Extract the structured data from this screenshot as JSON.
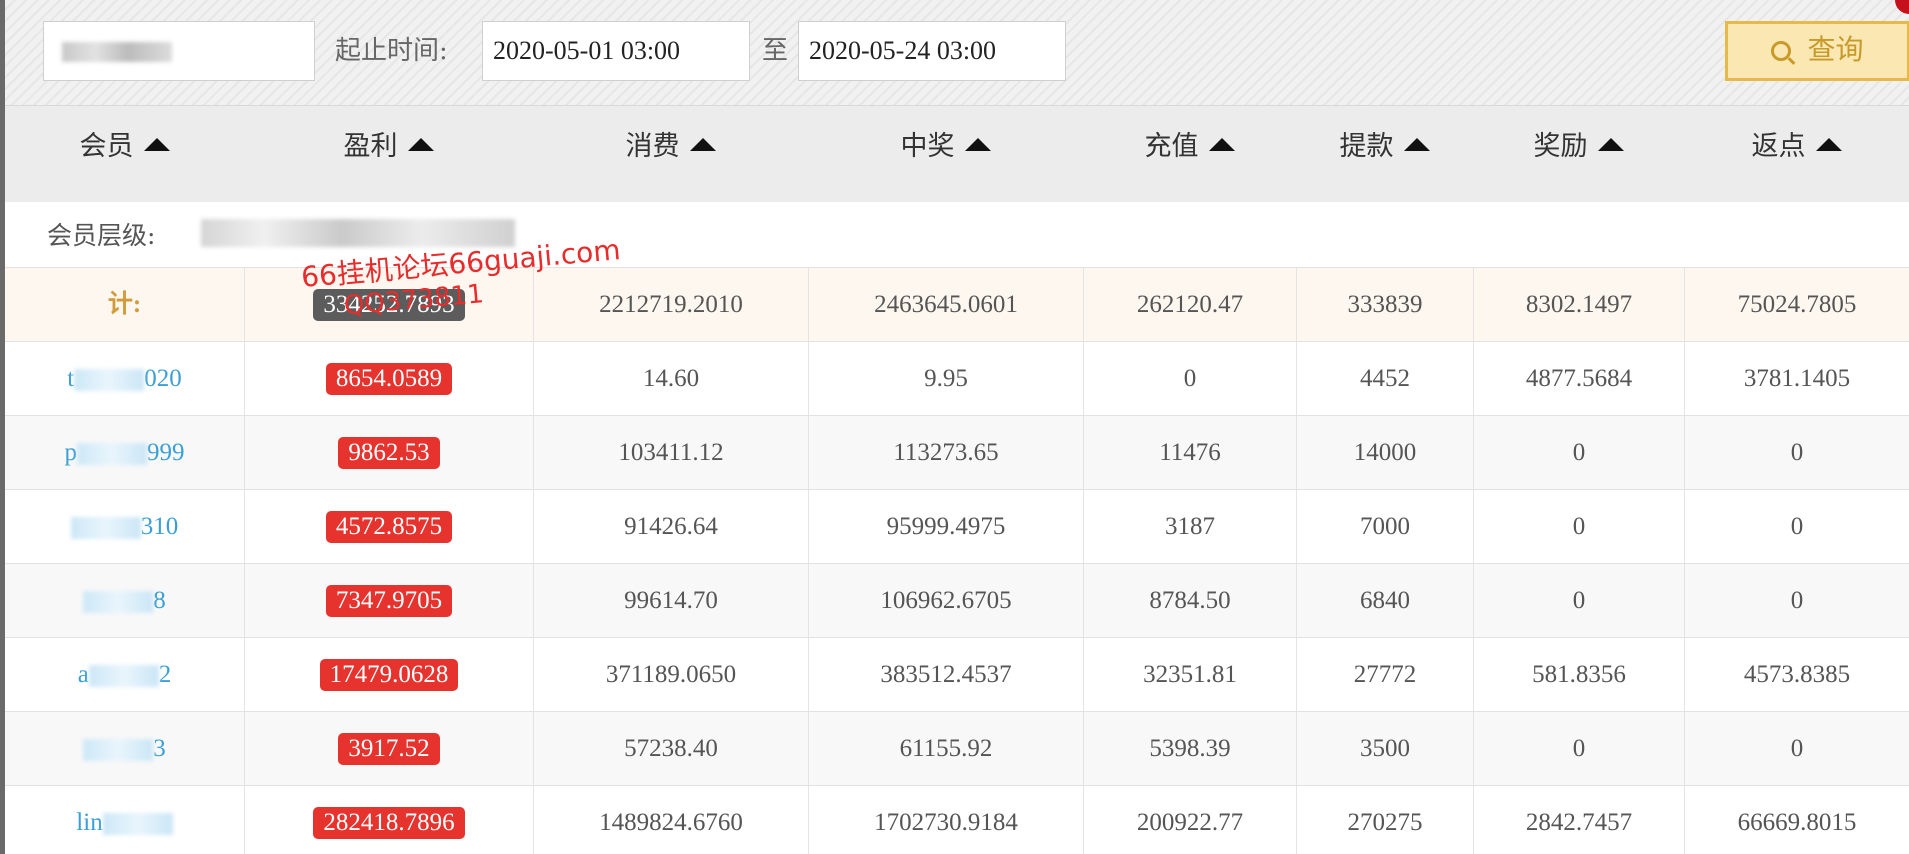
{
  "filters": {
    "time_label": "起止时间:",
    "start_date": "2020-05-01 03:00",
    "to_label": "至",
    "end_date": "2020-05-24 03:00",
    "query_label": "查询"
  },
  "columns": [
    "会员",
    "盈利",
    "消费",
    "中奖",
    "充值",
    "提款",
    "奖励",
    "返点"
  ],
  "level_label": "会员层级:",
  "total": {
    "label": "计:",
    "profit": "334252.7893",
    "consume": "2212719.2010",
    "win": "2463645.0601",
    "recharge": "262120.47",
    "withdraw": "333839",
    "reward": "8302.1497",
    "rebate": "75024.7805"
  },
  "rows": [
    {
      "member_prefix": "t",
      "member_suffix": "020",
      "profit": "8654.0589",
      "consume": "14.60",
      "win": "9.95",
      "recharge": "0",
      "withdraw": "4452",
      "reward": "4877.5684",
      "rebate": "3781.1405"
    },
    {
      "member_prefix": "p",
      "member_suffix": "999",
      "profit": "9862.53",
      "consume": "103411.12",
      "win": "113273.65",
      "recharge": "11476",
      "withdraw": "14000",
      "reward": "0",
      "rebate": "0"
    },
    {
      "member_prefix": "",
      "member_suffix": "310",
      "profit": "4572.8575",
      "consume": "91426.64",
      "win": "95999.4975",
      "recharge": "3187",
      "withdraw": "7000",
      "reward": "0",
      "rebate": "0"
    },
    {
      "member_prefix": "",
      "member_suffix": "8",
      "profit": "7347.9705",
      "consume": "99614.70",
      "win": "106962.6705",
      "recharge": "8784.50",
      "withdraw": "6840",
      "reward": "0",
      "rebate": "0"
    },
    {
      "member_prefix": "a",
      "member_suffix": "2",
      "profit": "17479.0628",
      "consume": "371189.0650",
      "win": "383512.4537",
      "recharge": "32351.81",
      "withdraw": "27772",
      "reward": "581.8356",
      "rebate": "4573.8385"
    },
    {
      "member_prefix": "",
      "member_suffix": "3",
      "profit": "3917.52",
      "consume": "57238.40",
      "win": "61155.92",
      "recharge": "5398.39",
      "withdraw": "3500",
      "reward": "0",
      "rebate": "0"
    },
    {
      "member_prefix": "lin",
      "member_suffix": "",
      "profit": "282418.7896",
      "consume": "1489824.6760",
      "win": "1702730.9184",
      "recharge": "200922.77",
      "withdraw": "270275",
      "reward": "2842.7457",
      "rebate": "66669.8015"
    }
  ],
  "watermark": {
    "line1": "66挂机论坛66guaji.com",
    "line2": "QQ373811"
  },
  "colors": {
    "profit_badge": "#e6332e",
    "total_badge": "#5c5c5c",
    "member_link": "#3a9fd5",
    "query_button_border": "#e7b94b"
  }
}
